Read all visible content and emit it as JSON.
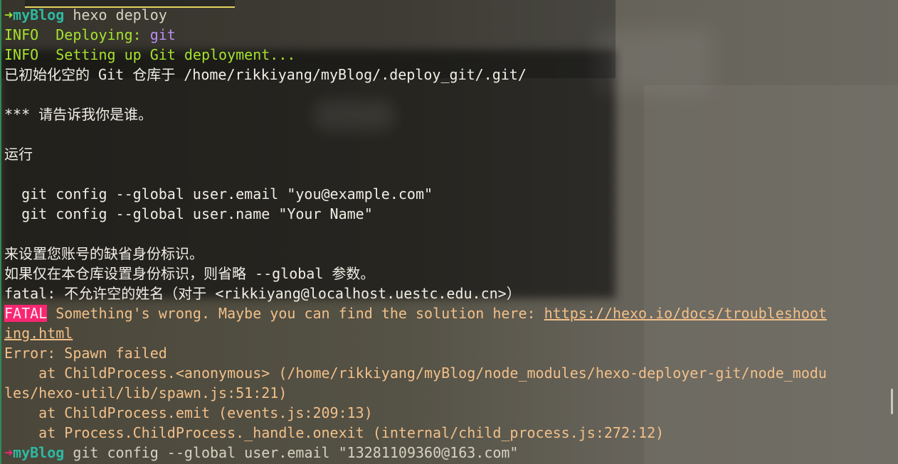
{
  "prompt": {
    "arrow": "➜",
    "dir": "myBlog"
  },
  "lines": {
    "cmd1": "hexo deploy",
    "info_tag": "INFO",
    "deploying_label": "Deploying: ",
    "deploying_value": "git",
    "setup_text": "Setting up Git deployment...",
    "init_repo": "已初始化空的 Git 仓库于 /home/rikkiyang/myBlog/.deploy_git/.git/",
    "tell_me": "*** 请告诉我你是谁。",
    "run": "运行",
    "git_email": "  git config --global user.email \"you@example.com\"",
    "git_name": "  git config --global user.name \"Your Name\"",
    "set_identity": "来设置您账号的缺省身份标识。",
    "only_repo": "如果仅在本仓库设置身份标识，则省略 --global 参数。",
    "fatal_empty": "fatal: 不允许空的姓名（对于 <rikkiyang@localhost.uestc.edu.cn>）",
    "fatal_badge": "FATAL",
    "fatal_msg": " Something's wrong. Maybe you can find the solution here: ",
    "fatal_link_1": "https://hexo.io/docs/troubleshoot",
    "fatal_link_2": "ing.html",
    "error_spawn": "Error: Spawn failed",
    "stack_1a": "    at ChildProcess.<anonymous> (/home/rikkiyang/myBlog/node_modules/hexo-deployer-git/node_modu",
    "stack_1b": "les/hexo-util/lib/spawn.js:51:21)",
    "stack_2": "    at ChildProcess.emit (events.js:209:13)",
    "stack_3": "    at Process.ChildProcess._handle.onexit (internal/child_process.js:272:12)",
    "cmd2": "git config --global user.email \"13281109360@163.com\""
  },
  "colors": {
    "green": "#a6e22e",
    "pink": "#f92672",
    "teal": "#2fb8a0",
    "purple": "#b98cf2",
    "peach": "#f2c089"
  }
}
